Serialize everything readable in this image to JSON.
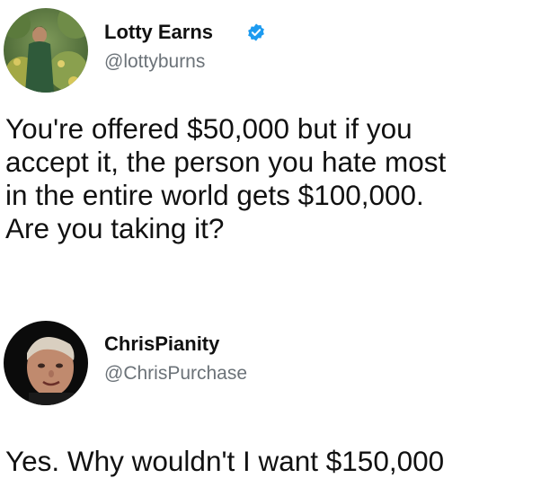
{
  "tweet_1": {
    "author": {
      "name": "Lotty Earns",
      "handle": "@lottyburns",
      "verified": true,
      "avatar_icon": "profile-photo-outdoor-garden"
    },
    "text_lines": [
      "You're offered $50,000 but if you",
      "accept it, the person you hate most",
      "in the entire world gets $100,000.",
      "Are you taking it?"
    ]
  },
  "tweet_2": {
    "author": {
      "name": "ChrisPianity",
      "handle": "@ChrisPurchase",
      "verified": false,
      "avatar_icon": "profile-photo-face"
    },
    "text_lines": [
      "Yes. Why wouldn't I want $150,000"
    ]
  },
  "colors": {
    "background": "#ffffff",
    "text": "#111111",
    "handle": "#6b7278",
    "verified_badge": "#1d9bf0"
  }
}
